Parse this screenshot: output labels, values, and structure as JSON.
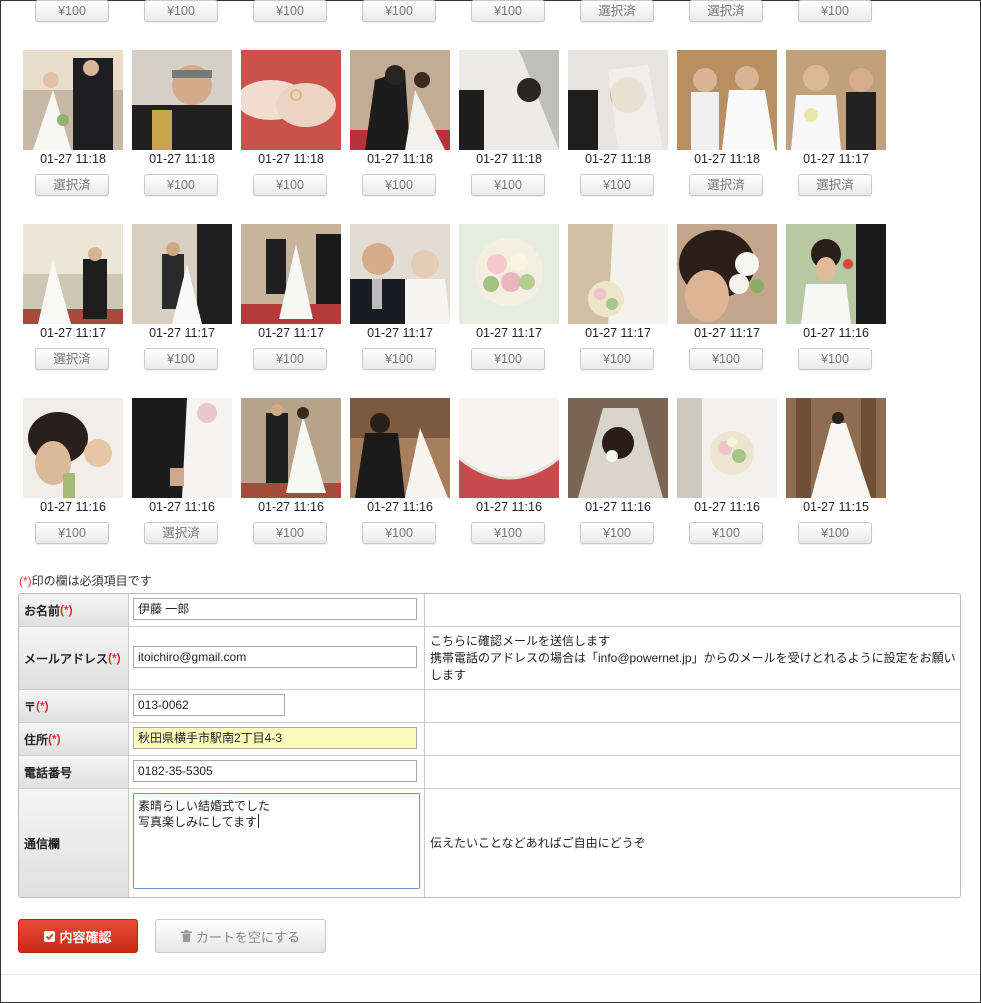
{
  "rows": [
    {
      "items": [
        {
          "time": "",
          "button": "¥100"
        },
        {
          "time": "",
          "button": "¥100"
        },
        {
          "time": "",
          "button": "¥100"
        },
        {
          "time": "",
          "button": "¥100"
        },
        {
          "time": "",
          "button": "¥100"
        },
        {
          "time": "",
          "button": "選択済"
        },
        {
          "time": "",
          "button": "選択済"
        },
        {
          "time": "",
          "button": "¥100"
        }
      ]
    },
    {
      "items": [
        {
          "time": "01-27 11:18",
          "button": "選択済",
          "image": "bride-and-groom-walking"
        },
        {
          "time": "01-27 11:18",
          "button": "¥100",
          "image": "priest-portrait"
        },
        {
          "time": "01-27 11:18",
          "button": "¥100",
          "image": "ring-exchange-hands"
        },
        {
          "time": "01-27 11:18",
          "button": "¥100",
          "image": "couple-bowing"
        },
        {
          "time": "01-27 11:18",
          "button": "¥100",
          "image": "veil-lifting"
        },
        {
          "time": "01-27 11:18",
          "button": "¥100",
          "image": "bride-veil-closeup"
        },
        {
          "time": "01-27 11:18",
          "button": "選択済",
          "image": "flower-children"
        },
        {
          "time": "01-27 11:17",
          "button": "選択済",
          "image": "flower-girl-and-boy"
        }
      ]
    },
    {
      "items": [
        {
          "time": "01-27 11:17",
          "button": "選択済",
          "image": "chapel-altar"
        },
        {
          "time": "01-27 11:17",
          "button": "¥100",
          "image": "father-and-bride-aisle"
        },
        {
          "time": "01-27 11:17",
          "button": "¥100",
          "image": "aisle-walk"
        },
        {
          "time": "01-27 11:17",
          "button": "¥100",
          "image": "father-portrait"
        },
        {
          "time": "01-27 11:17",
          "button": "¥100",
          "image": "bouquet-closeup"
        },
        {
          "time": "01-27 11:17",
          "button": "¥100",
          "image": "bride-holding-bouquet"
        },
        {
          "time": "01-27 11:17",
          "button": "¥100",
          "image": "hair-flowers"
        },
        {
          "time": "01-27 11:16",
          "button": "¥100",
          "image": "bride-profile"
        }
      ]
    },
    {
      "items": [
        {
          "time": "01-27 11:16",
          "button": "¥100",
          "image": "bride-side-closeup"
        },
        {
          "time": "01-27 11:16",
          "button": "選択済",
          "image": "groom-hand-bouquet"
        },
        {
          "time": "01-27 11:16",
          "button": "¥100",
          "image": "couple-at-altar"
        },
        {
          "time": "01-27 11:16",
          "button": "¥100",
          "image": "couple-walking-away"
        },
        {
          "time": "01-27 11:16",
          "button": "¥100",
          "image": "dress-train-red-carpet"
        },
        {
          "time": "01-27 11:16",
          "button": "¥100",
          "image": "veil-back-view"
        },
        {
          "time": "01-27 11:16",
          "button": "¥100",
          "image": "bouquet-on-dress"
        },
        {
          "time": "01-27 11:15",
          "button": "¥100",
          "image": "bride-back-chapel"
        }
      ]
    }
  ],
  "form": {
    "required_mark": "(*)",
    "required_note": "印の欄は必須項目です",
    "name": {
      "label": "お名前",
      "value": "伊藤 一郎"
    },
    "email": {
      "label": "メールアドレス",
      "value": "itoichiro@gmail.com",
      "desc_line1": "こちらに確認メールを送信します",
      "desc_line2": "携帯電話のアドレスの場合は「info@powernet.jp」からのメールを受けとれるように設定をお願いします"
    },
    "zip": {
      "label": "〒",
      "value": "013-0062"
    },
    "address": {
      "label": "住所",
      "value": "秋田県横手市駅南2丁目4-3"
    },
    "phone": {
      "label": "電話番号",
      "value": "0182-35-5305"
    },
    "message": {
      "label": "通信欄",
      "line1": "素晴らしい結婚式でした",
      "line2": "写真楽しみにしてます",
      "desc": "伝えたいことなどあればご自由にどうぞ"
    }
  },
  "buttons": {
    "confirm": "内容確認",
    "clear_cart": "カートを空にする"
  },
  "icons": {
    "confirm": "checkbox-check-icon",
    "clear_cart": "trash-icon"
  },
  "colors": {
    "confirm_button": "#d83a24",
    "required_mark": "#dd3333",
    "highlight_input": "#fbfbbf"
  }
}
